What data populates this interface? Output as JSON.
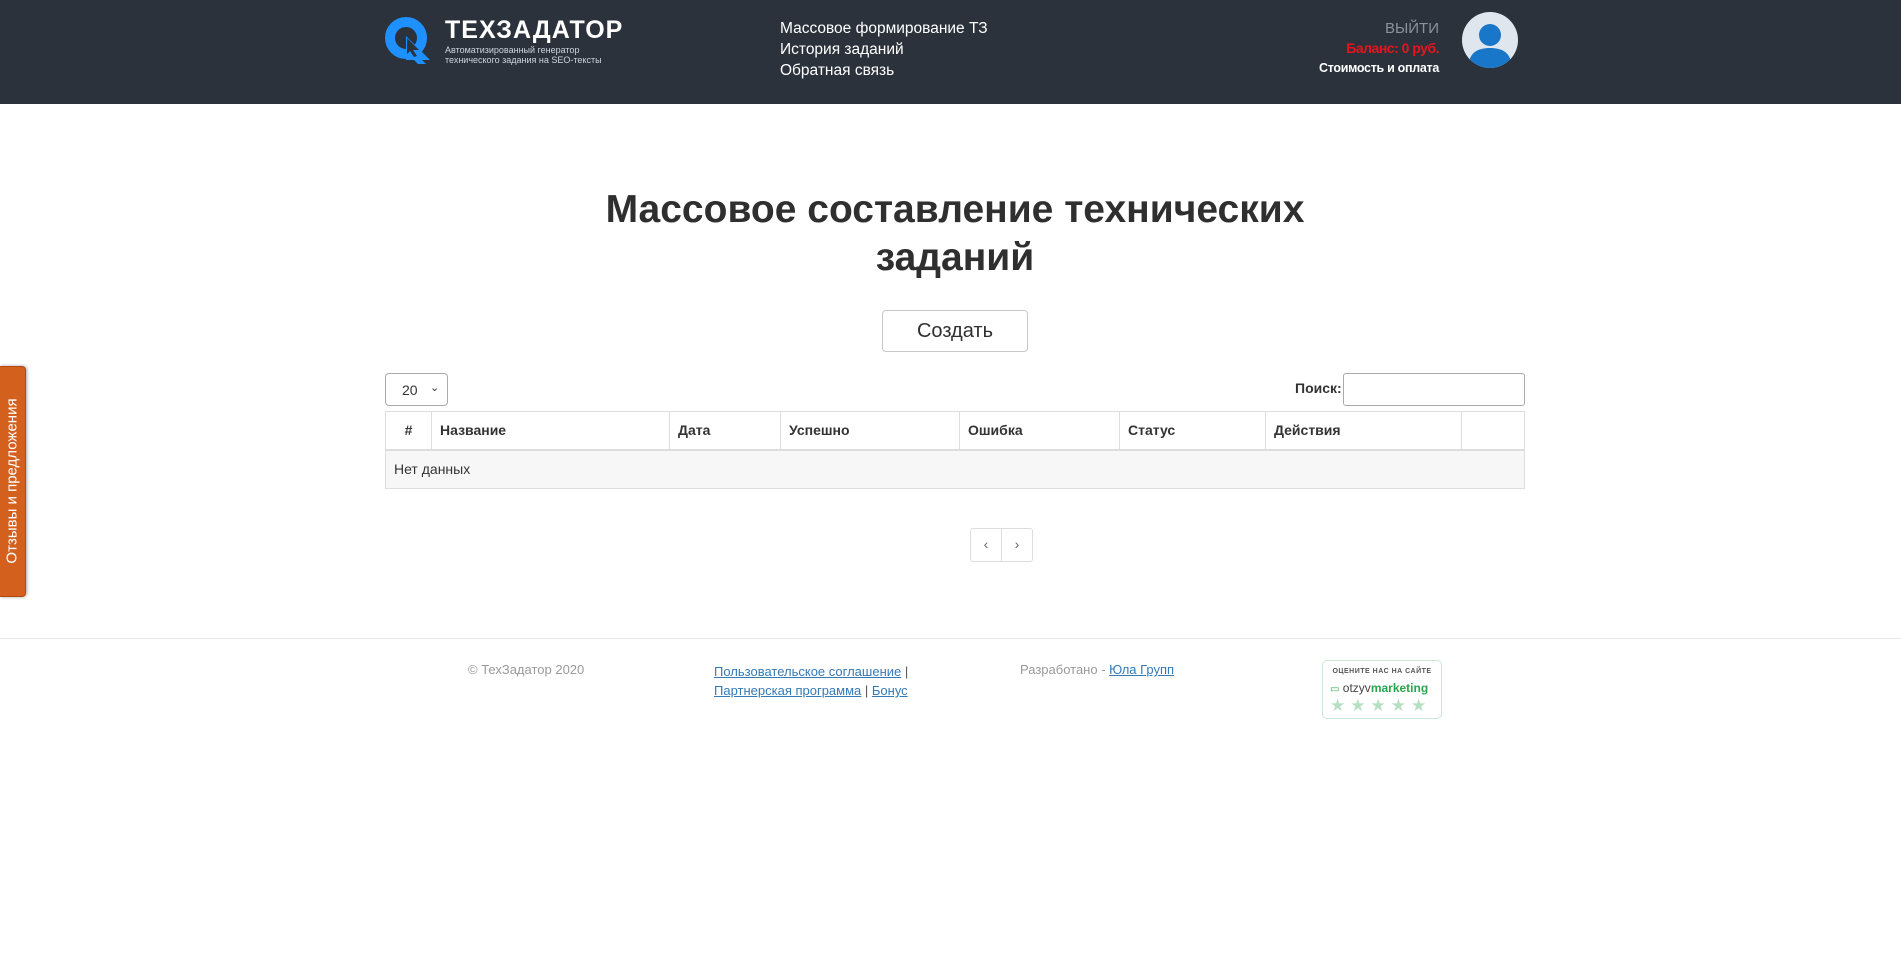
{
  "header": {
    "brand_title": "ТЕХЗАДАТОР",
    "brand_subtitle_line1": "Автоматизированный генератор",
    "brand_subtitle_line2": "технического задания на SEO-тексты",
    "nav": [
      {
        "label": "Массовое формирование ТЗ"
      },
      {
        "label": "История заданий"
      },
      {
        "label": "Обратная связь"
      }
    ],
    "logout": "ВЫЙТИ",
    "balance": "Баланс: 0 руб.",
    "pricing": "Стоимость и оплата"
  },
  "feedback_tab": "Отзывы и предложения",
  "main": {
    "title": "Массовое составление технических заданий",
    "create_button": "Создать",
    "page_size": "20",
    "search_label": "Поиск:",
    "search_value": "",
    "columns": [
      "#",
      "Название",
      "Дата",
      "Успешно",
      "Ошибка",
      "Статус",
      "Действия",
      ""
    ],
    "empty_text": "Нет данных",
    "pager_prev": "‹",
    "pager_next": "›"
  },
  "footer": {
    "copyright": "© ТехЗадатор 2020",
    "link_agreement": "Пользовательское соглашение",
    "sep1": " |",
    "link_partner": "Партнерская программа",
    "sep2": " | ",
    "link_bonus": "Бонус",
    "dev_prefix": "Разработано - ",
    "dev_link": "Юла Групп",
    "rate_caption": "ОЦЕНИТЕ НАС НА САЙТЕ",
    "rate_brand_a": "otzyv",
    "rate_brand_b": "marketing",
    "rate_stars": "★★★★★"
  },
  "colors": {
    "header_bg": "#2b323c",
    "balance": "#e8141d",
    "feedback_tab": "#d4601e",
    "link": "#337ab7",
    "logo_blue": "#1e90ff"
  },
  "icons": {
    "logo": "logo-q-cursor-icon",
    "avatar": "user-avatar-icon",
    "select": "chevron-down-icon",
    "stars": "star-icon",
    "chat": "chat-bubble-icon"
  }
}
